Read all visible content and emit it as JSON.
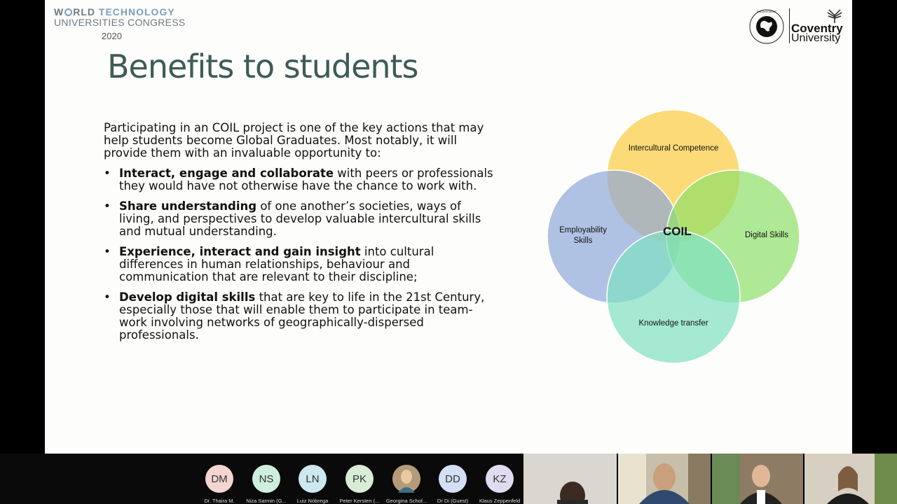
{
  "conference": {
    "line1_a": "W",
    "line1_b": "RLD ",
    "line1_tech": "TECHNOLOGY",
    "line2": "UNIVERSITIES CONGRESS",
    "year": "2020"
  },
  "university": {
    "name_line1": "Coventry",
    "name_line2": "University",
    "seal_text": "CENTRE FOR GLOBAL ENGAGEMENT"
  },
  "slide": {
    "title": "Benefits to students",
    "intro": "Participating in an COIL project is one of the key actions that may help students become Global Graduates. Most notably, it will provide them with an invaluable opportunity to:",
    "bullets": [
      {
        "bold": "Interact, engage and collaborate",
        "rest": " with peers or professionals they would have not otherwise have the chance to work with."
      },
      {
        "bold": "Share understanding",
        "rest": " of one another’s societies, ways of living, and perspectives to develop valuable intercultural skills and mutual understanding."
      },
      {
        "bold": "Experience, interact and gain insight",
        "rest": " into cultural differences in human relationships, behaviour and communication that are relevant to their discipline;"
      },
      {
        "bold": "Develop digital skills",
        "rest": " that are key to life in the 21st Century, especially those that will enable them to participate in team-work involving networks of geographically-dispersed professionals."
      }
    ],
    "bullet_symbol": "•"
  },
  "venn": {
    "center": "COIL",
    "top": "Intercultural Competence",
    "left_line1": "Employability",
    "left_line2": "Skills",
    "right": "Digital Skills",
    "bottom": "Knowledge transfer",
    "colors": {
      "top": "#fcd35f",
      "left": "#8fa8d8",
      "right": "#8ee06a",
      "bottom": "#7fe0c2"
    }
  },
  "participants": [
    {
      "initials": "DM",
      "name": "Dr. Thaira M.",
      "color": "#f3d6cf"
    },
    {
      "initials": "NS",
      "name": "Niza Sarmin (G...",
      "color": "#cfeedd"
    },
    {
      "initials": "LN",
      "name": "Luiz Nóbrega",
      "color": "#cde8ef"
    },
    {
      "initials": "PK",
      "name": "Peter Kersten (...",
      "color": "#d8ecd6"
    },
    {
      "initials": "",
      "name": "Georgina Schof...",
      "color": "#b39a7a"
    },
    {
      "initials": "DD",
      "name": "Dr Di (Guest)",
      "color": "#d3e0f4"
    },
    {
      "initials": "KZ",
      "name": "Klaus Zeppenfeld",
      "color": "#e0dbf0"
    }
  ]
}
